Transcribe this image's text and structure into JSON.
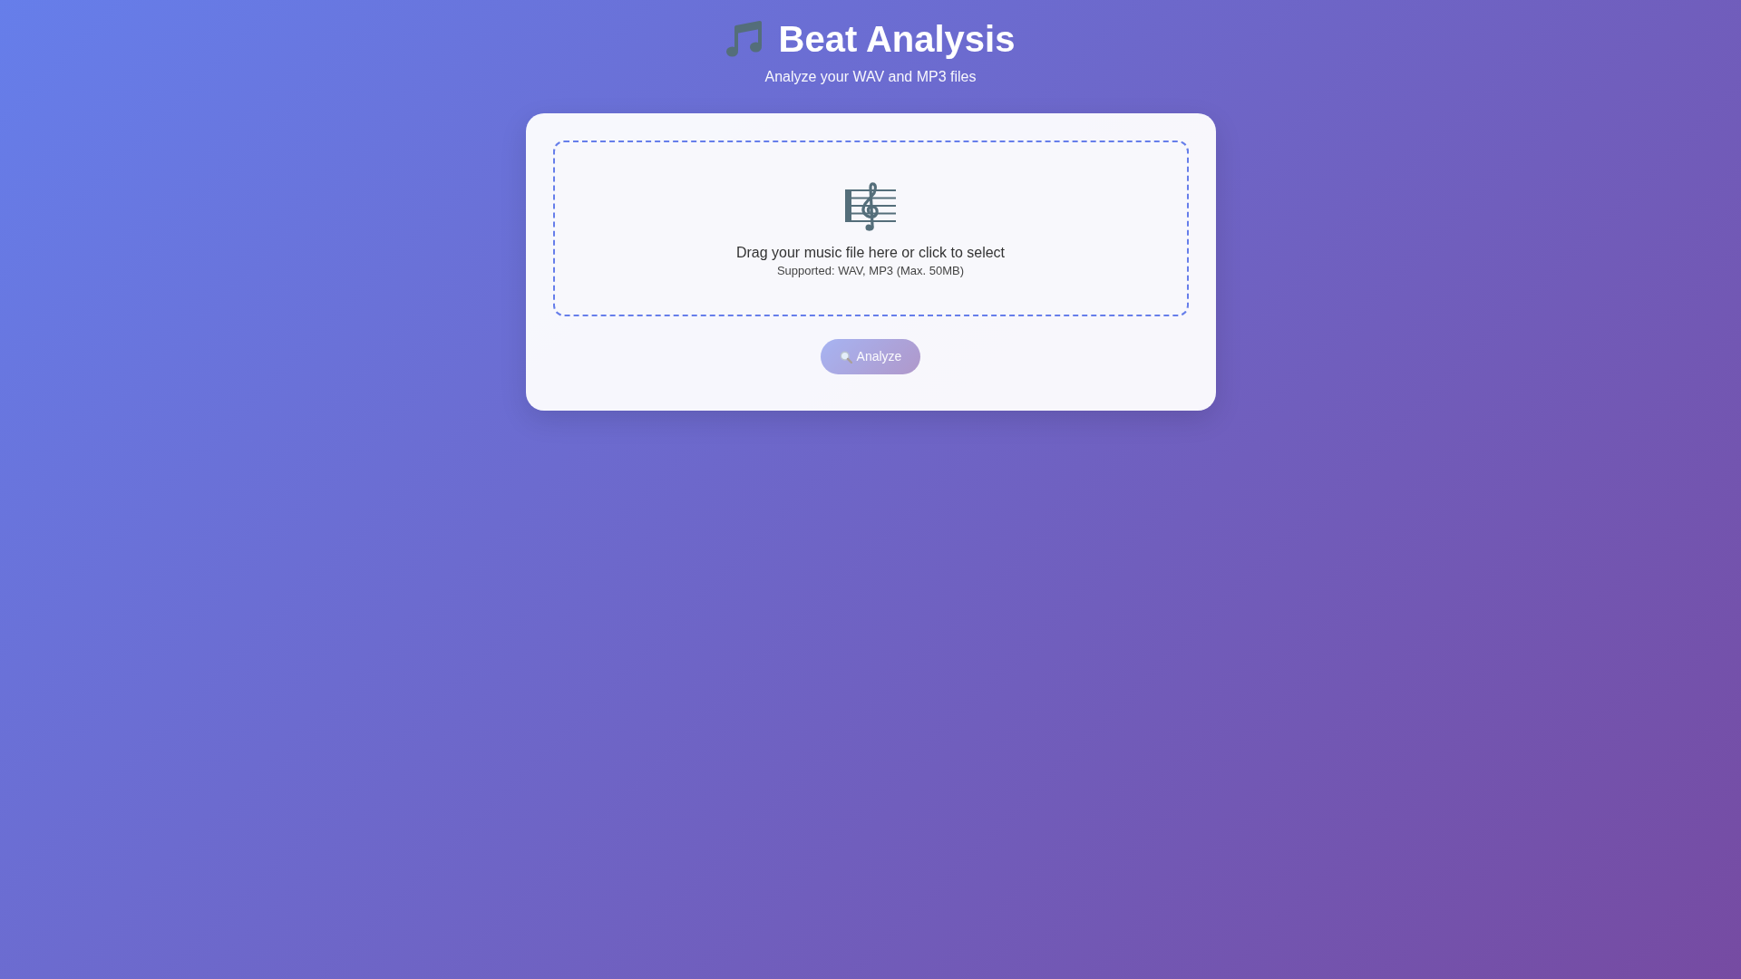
{
  "header": {
    "title": "Beat Analysis",
    "subtitle": "Analyze your WAV and MP3 files"
  },
  "upload": {
    "prompt": "Drag your music file here or click to select",
    "hint": "Supported: WAV, MP3 (Max. 50MB)"
  },
  "analyze_button": {
    "label": "Analyze",
    "disabled": true
  }
}
